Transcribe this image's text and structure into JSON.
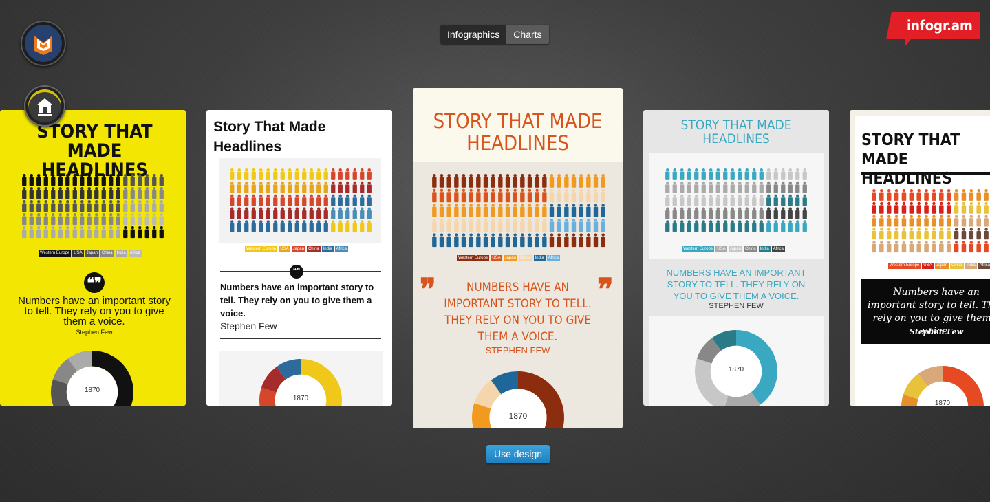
{
  "tabs": [
    {
      "label": "Infographics"
    },
    {
      "label": "Charts"
    }
  ],
  "brand": {
    "label": "infogr.am",
    "color": "#e21e26"
  },
  "use_design_label": "Use design",
  "accent": "#2a8ed0",
  "cards": [
    {
      "title": "STORY THAT MADE HEADLINES",
      "legend": [
        "Western Europe",
        "USA",
        "Japan",
        "China",
        "India",
        "Africa"
      ],
      "quote": "Numbers have an important story to tell. They rely on you to give them a voice.",
      "author": "Stephen Few",
      "center": "1870",
      "palette": [
        "#111111",
        "#333333",
        "#555555",
        "#888888",
        "#aaaaaa",
        "#bbbbbb"
      ],
      "bg": "#f2e602"
    },
    {
      "title": "Story That Made Headlines",
      "legend": [
        "Western Europe",
        "USA",
        "Japan",
        "China",
        "India",
        "Africa"
      ],
      "quote": "Numbers have an important story to tell. They rely on you to give them a voice.",
      "author": "Stephen Few",
      "center": "1870",
      "palette": [
        "#f0c81a",
        "#e8a517",
        "#d6462a",
        "#a62b2b",
        "#2d6c9a",
        "#4a8db5"
      ],
      "bg": "#ffffff"
    },
    {
      "title": "STORY THAT MADE HEADLINES",
      "legend": [
        "Western Europe",
        "USA",
        "Japan",
        "China",
        "India",
        "Africa"
      ],
      "quote": "NUMBERS HAVE AN IMPORTANT STORY TO TELL. THEY RELY ON YOU TO GIVE THEM A VOICE.",
      "author": "STEPHEN FEW",
      "center": "1870",
      "palette": [
        "#8c2d0f",
        "#d8541c",
        "#f29a1f",
        "#f5d5ac",
        "#1f6799",
        "#6ab0dd"
      ],
      "bg": "#ece8e0"
    },
    {
      "title": "STORY THAT MADE HEADLINES",
      "legend": [
        "Western Europe",
        "USA",
        "Japan",
        "China",
        "India",
        "Africa"
      ],
      "quote": "NUMBERS HAVE AN IMPORTANT STORY TO TELL. THEY RELY ON YOU TO GIVE THEM A VOICE.",
      "author": "STEPHEN FEW",
      "center": "1870",
      "palette": [
        "#3aa8c0",
        "#aaaaaa",
        "#c7c7c7",
        "#888888",
        "#2a7a88",
        "#444444"
      ],
      "bg": "#e8e8e8"
    },
    {
      "title": "STORY THAT MADE HEADLINES",
      "legend": [
        "Western Europe",
        "USA",
        "Japan",
        "China",
        "India",
        "Africa"
      ],
      "quote": "Numbers have an important story to tell. They rely on you to give them a voice.",
      "author": "Stephen Few",
      "center": "1870",
      "palette": [
        "#e54a23",
        "#d8211a",
        "#e88f2a",
        "#e8c23a",
        "#d8a878",
        "#6a4a3a"
      ],
      "bg": "#ffffff"
    }
  ]
}
